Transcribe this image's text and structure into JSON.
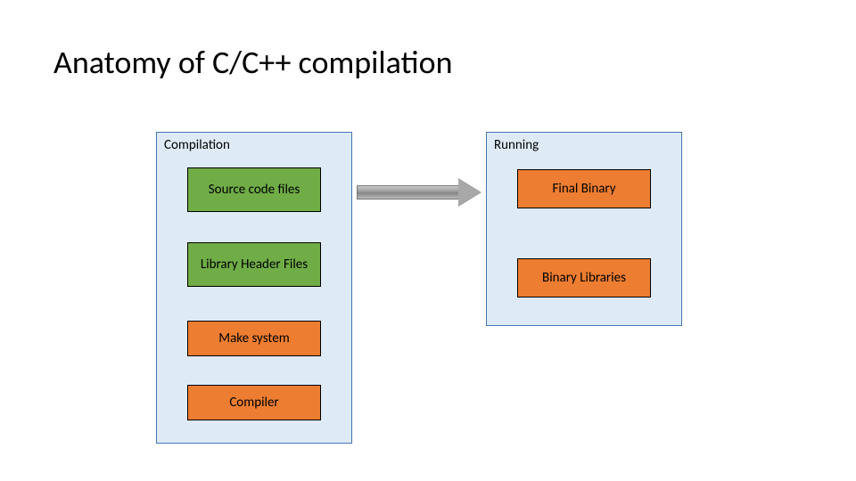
{
  "title": "Anatomy of C/C++ compilation",
  "groups": {
    "compilation": {
      "label": "Compilation"
    },
    "running": {
      "label": "Running"
    }
  },
  "nodes": {
    "source_code": "Source code files",
    "library_headers": "Library Header Files",
    "make_system": "Make system",
    "compiler": "Compiler",
    "final_binary": "Final Binary",
    "binary_libraries": "Binary Libraries"
  }
}
